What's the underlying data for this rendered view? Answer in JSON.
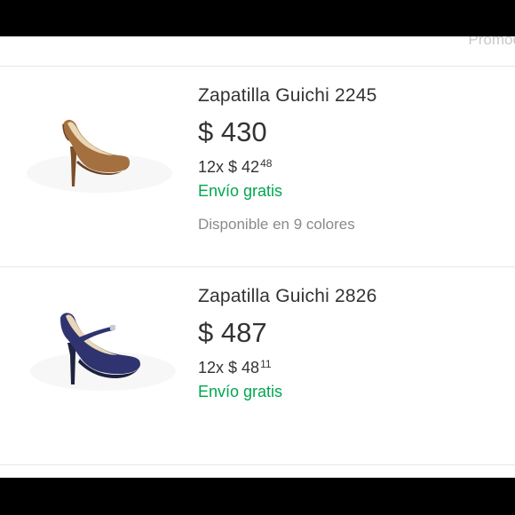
{
  "header": {
    "promo_label": "Promoc"
  },
  "colors": {
    "shipping": "#00a650",
    "text": "#333333",
    "muted": "#8a8a8a"
  },
  "products": [
    {
      "title": "Zapatilla Guichi 2245",
      "price": "$ 430",
      "installments_prefix": "12x $ 42",
      "installments_cents": "48",
      "shipping": "Envío gratis",
      "colors_text": "Disponible en 9 colores",
      "image_icon": "brown-pump-shoe"
    },
    {
      "title": "Zapatilla Guichi 2826",
      "price": "$ 487",
      "installments_prefix": "12x $ 48",
      "installments_cents": "11",
      "shipping": "Envío gratis",
      "image_icon": "navy-mary-jane-shoe"
    }
  ]
}
